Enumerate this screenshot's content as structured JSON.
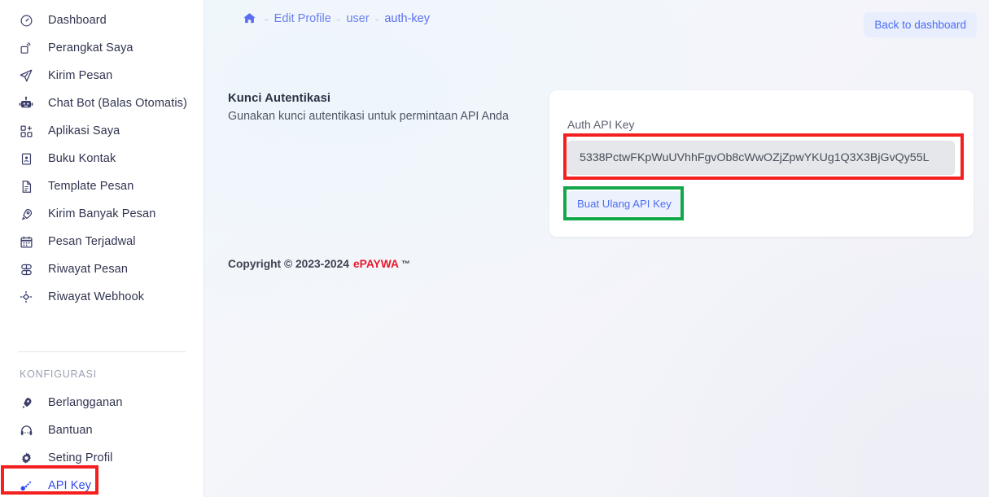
{
  "sidebar": {
    "items": [
      {
        "label": "Dashboard",
        "icon": "gauge-icon"
      },
      {
        "label": "Perangkat Saya",
        "icon": "device-signal-icon"
      },
      {
        "label": "Kirim Pesan",
        "icon": "paper-plane-icon"
      },
      {
        "label": "Chat Bot (Balas Otomatis)",
        "icon": "robot-icon"
      },
      {
        "label": "Aplikasi Saya",
        "icon": "grid-plus-icon"
      },
      {
        "label": "Buku Kontak",
        "icon": "contact-book-icon"
      },
      {
        "label": "Template Pesan",
        "icon": "document-icon"
      },
      {
        "label": "Kirim Banyak Pesan",
        "icon": "rocket-icon"
      },
      {
        "label": "Pesan Terjadwal",
        "icon": "calendar-icon"
      },
      {
        "label": "Riwayat Pesan",
        "icon": "stacked-layers-icon"
      },
      {
        "label": "Riwayat Webhook",
        "icon": "webhook-node-icon"
      }
    ],
    "config_heading": "KONFIGURASI",
    "config_items": [
      {
        "label": "Berlangganan",
        "icon": "rocket-icon",
        "active": false
      },
      {
        "label": "Bantuan",
        "icon": "headset-icon",
        "active": false
      },
      {
        "label": "Seting Profil",
        "icon": "gear-icon",
        "active": false
      },
      {
        "label": "API Key",
        "icon": "key-icon",
        "active": true
      }
    ]
  },
  "breadcrumb": {
    "home_icon": "home-icon",
    "separator": "-",
    "items": [
      "Edit Profile",
      "user",
      "auth-key"
    ]
  },
  "header": {
    "back_button": "Back to dashboard"
  },
  "section": {
    "title": "Kunci Autentikasi",
    "subtitle": "Gunakan kunci autentikasi untuk permintaan API Anda"
  },
  "card": {
    "label": "Auth API Key",
    "api_key_value": "5338PctwFKpWuUVhhFgvOb8cWwOZjZpwYKUg1Q3X3BjGvQy55L",
    "api_key_placeholder": "Auth API Key",
    "regen_button": "Buat Ulang API Key"
  },
  "footer": {
    "copyright": "Copyright © 2023-2024",
    "brand": "ePAYWA",
    "tm": "™"
  },
  "colors": {
    "accent_blue": "#2f49f2",
    "link_blue": "#6b7ff0",
    "brand_red": "#e8192c",
    "annotation_red": "#f42020",
    "annotation_green": "#12a84a"
  }
}
